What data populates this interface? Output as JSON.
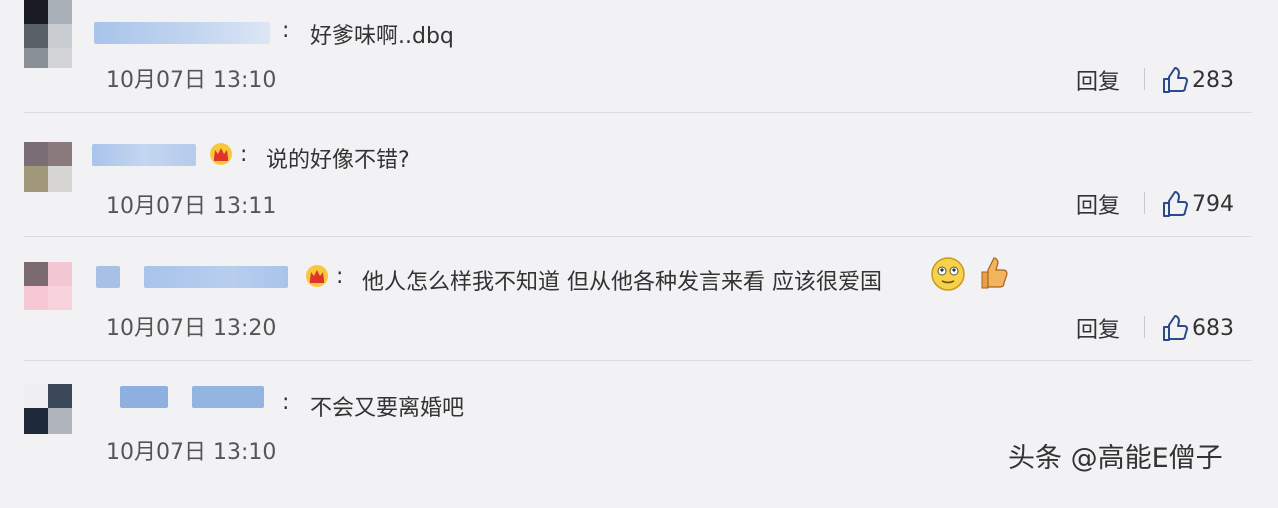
{
  "comments": [
    {
      "text": "好爹味啊..dbq",
      "time": "10月07日 13:10",
      "reply_label": "回复",
      "likes": "283",
      "has_crown": false
    },
    {
      "text": "说的好像不错?",
      "time": "10月07日 13:11",
      "reply_label": "回复",
      "likes": "794",
      "has_crown": true
    },
    {
      "text": "他人怎么样我不知道 但从他各种发言来看 应该很爱国",
      "time": "10月07日 13:20",
      "reply_label": "回复",
      "likes": "683",
      "has_crown": true
    },
    {
      "text": "不会又要离婚吧",
      "time": "10月07日 13:10",
      "has_crown": false
    }
  ],
  "colon": ":",
  "watermark": "头条 @高能E僧子",
  "colors": {
    "background": "#f2f2f5",
    "name_blur": "#a8c4ea",
    "divider": "#dcdce2"
  },
  "icons": [
    "crown-icon",
    "thumbs-up-icon",
    "smiley-icon",
    "thumbs-up-emoji"
  ]
}
